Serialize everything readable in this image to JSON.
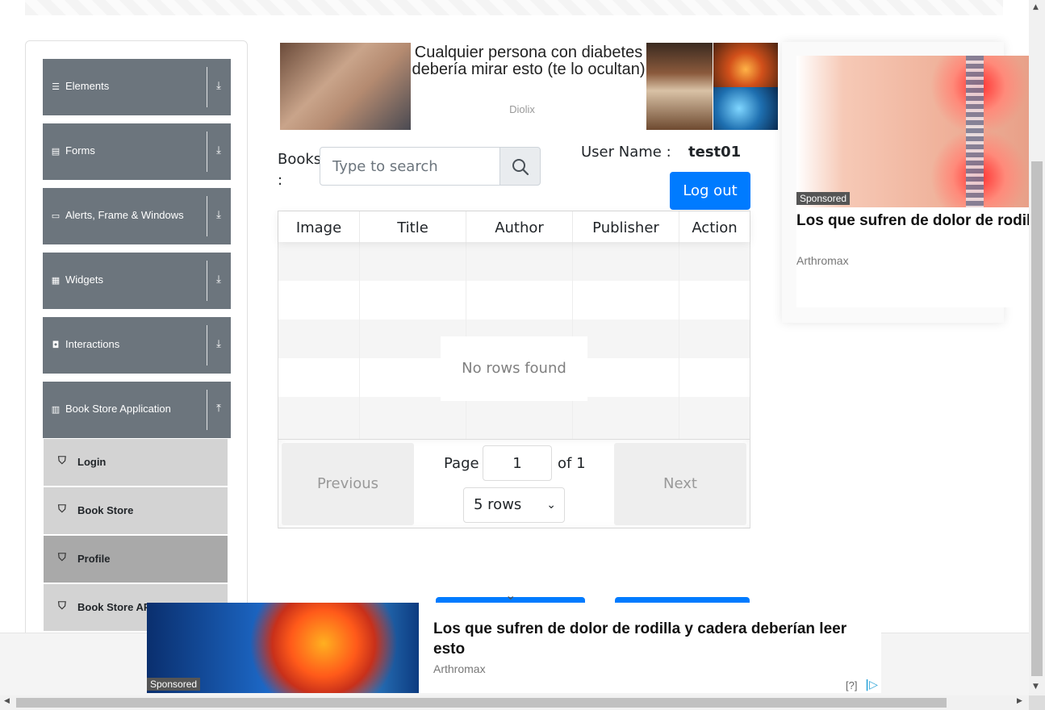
{
  "sidebar": {
    "groups": [
      {
        "label": "Elements",
        "icon": "hamburger-icon",
        "arrow": "download-arrow-icon"
      },
      {
        "label": "Forms",
        "icon": "form-icon",
        "arrow": "download-arrow-icon"
      },
      {
        "label": "Alerts, Frame & Windows",
        "icon": "window-icon",
        "arrow": "download-arrow-icon"
      },
      {
        "label": "Widgets",
        "icon": "grid-icon",
        "arrow": "download-arrow-icon"
      },
      {
        "label": "Interactions",
        "icon": "interaction-icon",
        "arrow": "download-arrow-icon"
      },
      {
        "label": "Book Store Application",
        "icon": "books-icon",
        "arrow": "upload-arrow-icon"
      }
    ],
    "items": [
      {
        "label": "Login",
        "active": false
      },
      {
        "label": "Book Store",
        "active": false
      },
      {
        "label": "Profile",
        "active": true
      },
      {
        "label": "Book Store API",
        "active": false
      }
    ]
  },
  "ad_top": {
    "title": "Cualquier persona con diabetes debería mirar esto (te lo ocultan)",
    "source": "Diolix"
  },
  "search": {
    "label": "Books :",
    "placeholder": "Type to search"
  },
  "user": {
    "label": "User Name :",
    "value": "test01",
    "logout_label": "Log out"
  },
  "table": {
    "columns": [
      "Image",
      "Title",
      "Author",
      "Publisher",
      "Action"
    ],
    "empty_message": "No rows found"
  },
  "pagination": {
    "previous_label": "Previous",
    "next_label": "Next",
    "page_label": "Page",
    "current_page": "1",
    "of_label": "of 1",
    "rows_select": "5 rows"
  },
  "side_ad": {
    "sponsored": "Sponsored",
    "title": "Los que sufren de dolor de rodilla y cadera deberían leer esto",
    "source": "Arthromax"
  },
  "bottom_ad": {
    "sponsored": "Sponsored",
    "title": "Los que sufren de dolor de rodilla y cadera deberían leer esto",
    "source": "Arthromax",
    "adchoices": "[?]"
  },
  "colors": {
    "primary": "#007bff",
    "sidebar_group": "#6c757d",
    "sidebar_item": "#d3d3d3",
    "sidebar_item_active": "#a9a9a9"
  }
}
